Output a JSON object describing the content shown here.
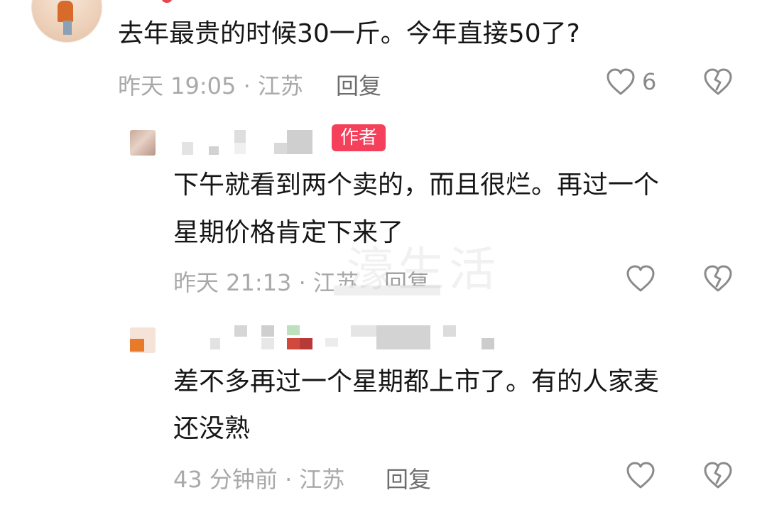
{
  "comments": [
    {
      "text": "去年最贵的时候30一斤。今年直接50了?",
      "time_location": "昨天 19:05 · 江苏",
      "reply_label": "回复",
      "like_count": "6"
    },
    {
      "badge": "作者",
      "text_line1": "下午就看到两个卖的，而且很烂。再过一个",
      "text_line2": "星期价格肯定下来了",
      "time_location": "昨天 21:13 · 江苏",
      "reply_label": "回复"
    },
    {
      "text_line1": "差不多再过一个星期都上市了。有的人家麦",
      "text_line2": "还没熟",
      "time_location": "43 分钟前 · 江苏",
      "reply_label": "回复"
    }
  ],
  "watermark": "濠生活",
  "icons": {
    "like": "heart-outline-icon",
    "dislike": "broken-heart-icon"
  },
  "colors": {
    "author_badge": "#f4405a",
    "text": "#161616",
    "meta": "#a9a9a9"
  }
}
